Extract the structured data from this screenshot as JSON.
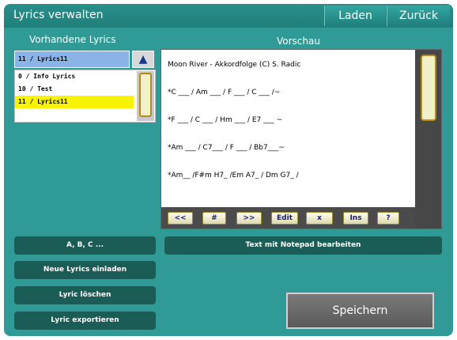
{
  "title": "Lyrics verwalten",
  "header_buttons": {
    "load": "Laden",
    "back": "Zurück"
  },
  "lyrics_panel": {
    "label": "Vorhandene Lyrics",
    "selected": "11 / Lyrics11",
    "items": [
      "0 / Info Lyrics",
      "10 / Test",
      "11 / Lyrics11"
    ]
  },
  "preview": {
    "label": "Vorschau",
    "lines": [
      "Moon River - Akkordfolge (C) S. Radic",
      "*C ___ / Am ___ / F ___ / C ___ /~",
      "*F ___ / C ___ / Hm ___ / E7 ___ ~",
      "*Am ___ / C7___ / F ___ / Bb7___~",
      "*Am__ /F#m H7_ /Em A7_ / Dm G7_ /"
    ],
    "toolbar": [
      "<<",
      "#",
      ">>",
      "Edit",
      "x",
      "Ins",
      "?"
    ]
  },
  "actions": {
    "abc": "A, B, C ...",
    "notepad": "Text mit Notepad bearbeiten",
    "load_new": "Neue Lyrics einladen",
    "delete": "Lyric löschen",
    "export": "Lyric exportieren",
    "save": "Speichern"
  },
  "colors": {
    "background": "#2f9a96",
    "selection_yellow": "#f8f400",
    "selection_blue": "#8ab4e8",
    "dark_button": "#1c5c56"
  }
}
